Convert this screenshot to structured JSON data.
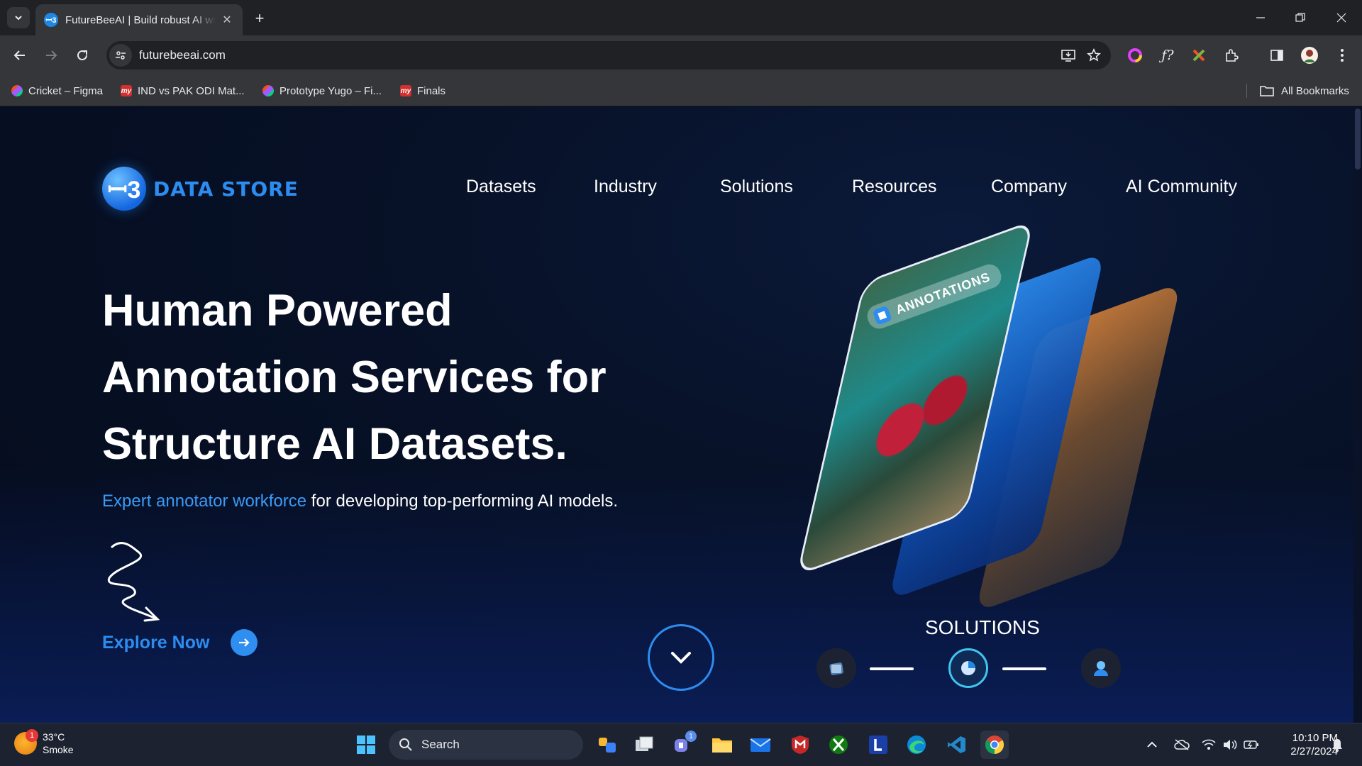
{
  "browser": {
    "tab_title": "FutureBeeAI | Build robust AI wi",
    "url": "futurebeeai.com",
    "bookmarks": [
      {
        "label": "Cricket – Figma",
        "icon": "figma-icon"
      },
      {
        "label": "IND vs PAK ODI Mat...",
        "icon": "my-icon"
      },
      {
        "label": "Prototype Yugo – Fi...",
        "icon": "figma-icon"
      },
      {
        "label": "Finals",
        "icon": "my-icon"
      }
    ],
    "all_bookmarks": "All Bookmarks"
  },
  "page": {
    "logo_text": "DATA STORE",
    "nav": [
      "Datasets",
      "Industry",
      "Solutions",
      "Resources",
      "Company",
      "AI Community"
    ],
    "hero_title": "Human Powered Annotation Services for Structure AI Datasets.",
    "hero_sub_accent": "Expert annotator workforce",
    "hero_sub_rest": " for developing top-performing AI models.",
    "explore_label": "Explore Now",
    "card_label": "ANNOTATIONS",
    "solutions_title": "SOLUTIONS",
    "accent_color": "#2d8cf0"
  },
  "taskbar": {
    "weather_temp": "33°C",
    "weather_desc": "Smoke",
    "weather_badge": "1",
    "search_label": "Search",
    "teams_badge": "1",
    "time": "10:10 PM",
    "date": "2/27/2024"
  }
}
